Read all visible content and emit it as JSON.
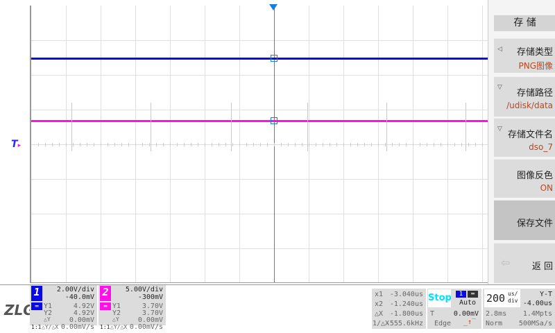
{
  "side_menu": {
    "title": "存 储",
    "items": [
      {
        "label": "存储类型",
        "value": "PNG图像"
      },
      {
        "label": "存储路径",
        "value": "/udisk/data"
      },
      {
        "label": "存储文件名",
        "value": "dso_7"
      },
      {
        "label": "图像反色",
        "value": "ON"
      },
      {
        "label": "保存文件"
      },
      {
        "label": "返 回"
      }
    ]
  },
  "logo": "ZLG",
  "ch1": {
    "num": "1",
    "scale": "2.00V/div",
    "offset": "-40.0mV",
    "y1_label": "Y1",
    "y1": "4.92V",
    "y2_label": "Y2",
    "y2": "4.92V",
    "dy_label": "△Y",
    "dy": "0.00mV",
    "ratio": "1:1",
    "dydx_label": "△Y/△X",
    "dydx": "0.00mV/s",
    "color": "#0a0ae6"
  },
  "ch2": {
    "num": "2",
    "scale": "5.00V/div",
    "offset": "-300mV",
    "y1_label": "Y1",
    "y1": "3.70V",
    "y2_label": "Y2",
    "y2": "3.70V",
    "dy_label": "△Y",
    "dy": "0.00mV",
    "ratio": "1:1",
    "dydx_label": "△Y/△X",
    "dydx": "0.00mV/s",
    "color": "#ff10e8"
  },
  "cursors": {
    "x1_label": "x1",
    "x1": "-3.040us",
    "x2_label": "x2",
    "x2": "-1.240us",
    "dx_label": "△X",
    "dx": "-1.800us",
    "inv_label": "1/△X",
    "inv": "-555.6kHz"
  },
  "trigger": {
    "status": "Stop",
    "source": "1",
    "mode": "Auto",
    "level_label": "T",
    "level": "0.00mV",
    "type": "Edge"
  },
  "timebase": {
    "value": "200",
    "unit_top": "us/",
    "unit_bottom": "div",
    "mode": "Y-T",
    "delay": "-4.00us",
    "window": "2.8ms",
    "points": "1.4Mpts",
    "acq": "Norm",
    "rate": "500MSa/s"
  }
}
